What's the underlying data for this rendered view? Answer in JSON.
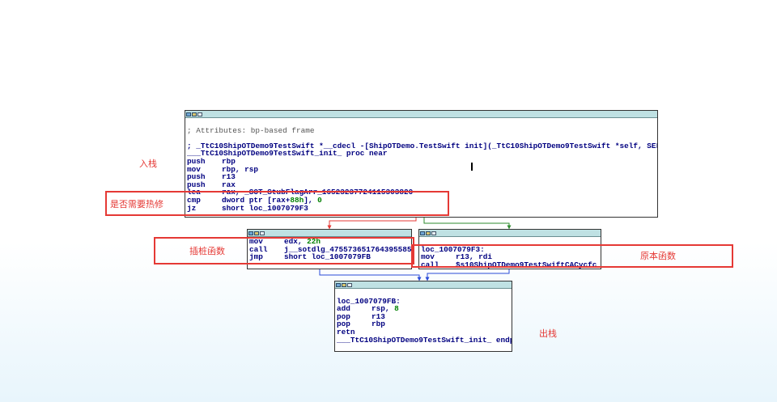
{
  "nodes": {
    "main": {
      "lines": [
        {
          "type": "blank"
        },
        {
          "type": "comment",
          "text": "; Attributes: bp-based frame"
        },
        {
          "type": "blank"
        },
        {
          "type": "text",
          "text": "; _TtC10ShipOTDemo9TestSwift *__cdecl -[ShipOTDemo.TestSwift init](_TtC10ShipOTDemo9TestSwift *self, SEL)"
        },
        {
          "type": "text",
          "text": "___TtC10ShipOTDemo9TestSwift_init_ proc near"
        },
        {
          "type": "instr",
          "mnemonic": "push",
          "operand": "rbp"
        },
        {
          "type": "instr",
          "mnemonic": "mov",
          "operand": "rbp, rsp"
        },
        {
          "type": "instr",
          "mnemonic": "push",
          "operand": "r13"
        },
        {
          "type": "instr",
          "mnemonic": "push",
          "operand": "rax"
        },
        {
          "type": "instr",
          "mnemonic": "lea",
          "operand": "rax, _SOT_StubFlagArr_16523237724115303820"
        },
        {
          "type": "instr",
          "mnemonic": "cmp",
          "operand": "dword ptr [rax+",
          "num": "88h",
          "tail": "], ",
          "num2": "0"
        },
        {
          "type": "instr",
          "mnemonic": "jz",
          "operand": "short loc_1007079F3"
        }
      ]
    },
    "left": {
      "lines": [
        {
          "type": "instr",
          "mnemonic": "mov",
          "operand": "edx, ",
          "num": "22h"
        },
        {
          "type": "instr",
          "mnemonic": "call",
          "operand": "j__sotdlg_4755736517643955850"
        },
        {
          "type": "instr",
          "mnemonic": "jmp",
          "operand": "short loc_1007079FB"
        }
      ]
    },
    "right": {
      "lines": [
        {
          "type": "blank"
        },
        {
          "type": "text",
          "text": "loc_1007079F3:"
        },
        {
          "type": "instr",
          "mnemonic": "mov",
          "operand": "r13, rdi"
        },
        {
          "type": "instr",
          "mnemonic": "call",
          "operand": "$s10ShipOTDemo9TestSwiftCACycfc"
        }
      ]
    },
    "bottom": {
      "lines": [
        {
          "type": "blank"
        },
        {
          "type": "text",
          "text": "loc_1007079FB:"
        },
        {
          "type": "instr",
          "mnemonic": "add",
          "operand": "rsp, ",
          "num": "8"
        },
        {
          "type": "instr",
          "mnemonic": "pop",
          "operand": "r13"
        },
        {
          "type": "instr",
          "mnemonic": "pop",
          "operand": "rbp"
        },
        {
          "type": "instr",
          "mnemonic": "retn",
          "operand": ""
        },
        {
          "type": "text",
          "text": "___TtC10ShipOTDemo9TestSwift_init_ endp"
        }
      ]
    }
  },
  "annotations": {
    "push_stack": "入栈",
    "needs_hotfix": "是否需要热修",
    "stub_function": "插桩函数",
    "original_function": "原本函数",
    "pop_stack": "出栈"
  },
  "colors": {
    "edge_false": "#e53935",
    "edge_true": "#2e8b2e",
    "edge_uncond": "#2a4bd7",
    "highlight": "#e53935",
    "code_text": "#000080",
    "number": "#008000"
  }
}
